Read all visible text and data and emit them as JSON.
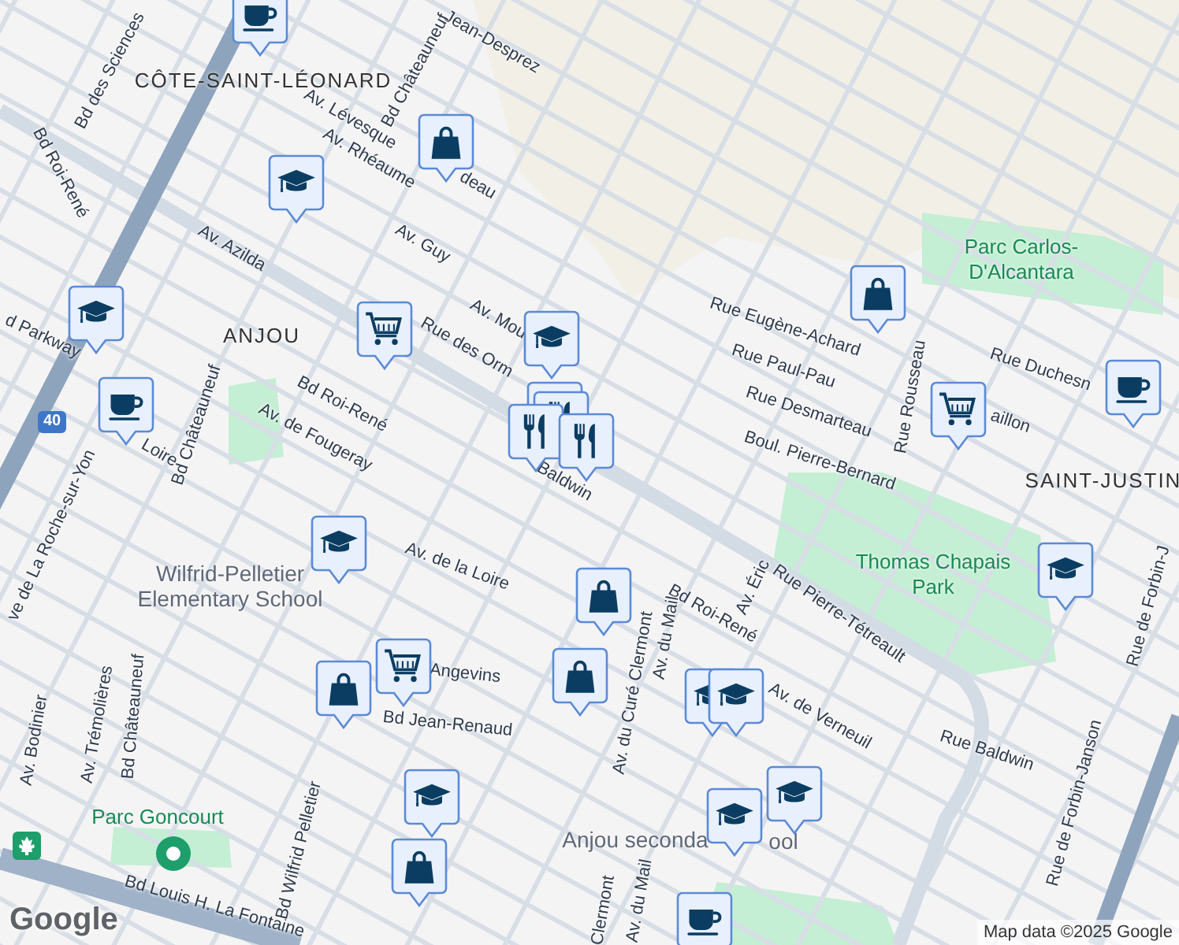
{
  "map": {
    "labels": [
      {
        "text": "Jean-Desprez",
        "kind": "street"
      },
      {
        "text": "Bd des Sciences",
        "kind": "street"
      },
      {
        "text": "CÔTE-SAINT-LÉONARD",
        "kind": "district"
      },
      {
        "text": "Bd Châteauneuf",
        "kind": "street"
      },
      {
        "text": "Av. Lévesque",
        "kind": "street"
      },
      {
        "text": "Av. Rhéaume",
        "kind": "street"
      },
      {
        "text": "deau",
        "kind": "street"
      },
      {
        "text": "Bd Roi-René",
        "kind": "street"
      },
      {
        "text": "Av. Azilda",
        "kind": "street"
      },
      {
        "text": "Av. Guy",
        "kind": "street"
      },
      {
        "text": "Av. Mou",
        "kind": "street"
      },
      {
        "text": "Rue des Orm",
        "kind": "street"
      },
      {
        "text": "d Parkway",
        "kind": "street"
      },
      {
        "text": "ANJOU",
        "kind": "district"
      },
      {
        "text": "Bd Roi-René",
        "kind": "street"
      },
      {
        "text": "Av. de Fougeray",
        "kind": "street"
      },
      {
        "text": "Bd Châteauneuf",
        "kind": "street"
      },
      {
        "text": "ve de La Roche-sur-Yon",
        "kind": "street"
      },
      {
        "text": "Loire",
        "kind": "street"
      },
      {
        "text": "Baldwin",
        "kind": "street"
      },
      {
        "text": "Rue Eugène-Achard",
        "kind": "street"
      },
      {
        "text": "Rue Paul-Pau",
        "kind": "street"
      },
      {
        "text": "Rue Desmarteau",
        "kind": "street"
      },
      {
        "text": "Boul. Pierre-Bernard",
        "kind": "street"
      },
      {
        "text": "Parc Carlos-D'Alcantara",
        "kind": "park"
      },
      {
        "text": "Rue Rousseau",
        "kind": "street"
      },
      {
        "text": "Rue Duchesn",
        "kind": "street"
      },
      {
        "text": "aillon",
        "kind": "street"
      },
      {
        "text": "SAINT-JUSTIN",
        "kind": "district"
      },
      {
        "text": "Wilfrid-Pelletier Elementary School",
        "kind": "poi"
      },
      {
        "text": "Av. de la Loire",
        "kind": "street"
      },
      {
        "text": "Thomas Chapais Park",
        "kind": "park"
      },
      {
        "text": "Av. Éric",
        "kind": "street"
      },
      {
        "text": "Rue Pierre-Tétreault",
        "kind": "street"
      },
      {
        "text": "Bd Roi-René",
        "kind": "street"
      },
      {
        "text": "Av. du Curé Clermont",
        "kind": "street"
      },
      {
        "text": "Av. du Mail",
        "kind": "street"
      },
      {
        "text": "Av. de Verneuil",
        "kind": "street"
      },
      {
        "text": "Rue Baldwin",
        "kind": "street"
      },
      {
        "text": "Rue de Forbin-Janson",
        "kind": "street"
      },
      {
        "text": "Rue de Forbin-J",
        "kind": "street"
      },
      {
        "text": "Bd Jean-Renaud",
        "kind": "street"
      },
      {
        "text": "Angevins",
        "kind": "street"
      },
      {
        "text": "Av. Trémolières",
        "kind": "street"
      },
      {
        "text": "Bd Châteauneuf",
        "kind": "street"
      },
      {
        "text": "Av. Bodinier",
        "kind": "street"
      },
      {
        "text": "Parc Goncourt",
        "kind": "park"
      },
      {
        "text": "Bd Louis H. La Fontaine",
        "kind": "street"
      },
      {
        "text": "Bd Wilfrid Pelletier",
        "kind": "street"
      },
      {
        "text": "Anjou seconda",
        "kind": "poi"
      },
      {
        "text": "Clermont",
        "kind": "street"
      },
      {
        "text": "Av. du Mail",
        "kind": "street"
      },
      {
        "text": "ool",
        "kind": "poi"
      }
    ],
    "markers": [
      {
        "kind": "cafe"
      },
      {
        "kind": "shopping"
      },
      {
        "kind": "school"
      },
      {
        "kind": "school"
      },
      {
        "kind": "grocery"
      },
      {
        "kind": "school"
      },
      {
        "kind": "food"
      },
      {
        "kind": "food"
      },
      {
        "kind": "food"
      },
      {
        "kind": "food"
      },
      {
        "kind": "cafe"
      },
      {
        "kind": "shopping"
      },
      {
        "kind": "grocery"
      },
      {
        "kind": "cafe"
      },
      {
        "kind": "school"
      },
      {
        "kind": "shopping"
      },
      {
        "kind": "school"
      },
      {
        "kind": "school"
      },
      {
        "kind": "school"
      },
      {
        "kind": "grocery"
      },
      {
        "kind": "shopping"
      },
      {
        "kind": "shopping"
      },
      {
        "kind": "school"
      },
      {
        "kind": "school"
      },
      {
        "kind": "school"
      },
      {
        "kind": "shopping"
      },
      {
        "kind": "cafe"
      }
    ],
    "highway_shield": "40",
    "logo": "Google",
    "attribution": "Map data ©2025 Google"
  }
}
